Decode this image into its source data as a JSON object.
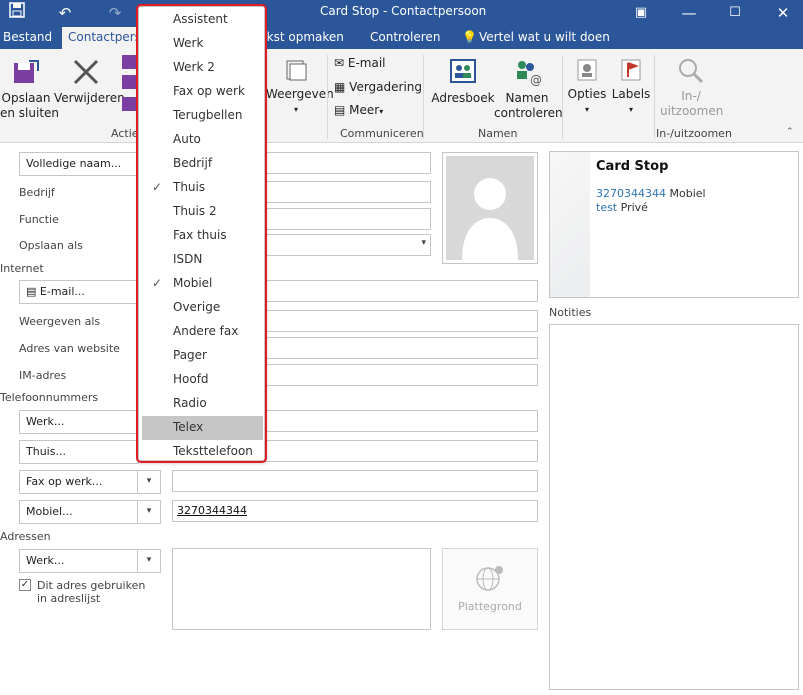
{
  "window": {
    "title": "Card Stop  - Contactpersoon"
  },
  "tabs": {
    "file": "Bestand",
    "contact": "Contactpersoon",
    "format": "Tekst opmaken",
    "review": "Controleren",
    "tell": "Vertel wat u wilt doen"
  },
  "ribbon": {
    "save_close_1": "Opslaan",
    "save_close_2": "en sluiten",
    "delete": "Verwijderen",
    "actions_group": "Acties",
    "show": "Weergeven",
    "email": "E-mail",
    "meeting": "Vergadering",
    "more": "Meer",
    "communicate_group": "Communiceren",
    "addressbook": "Adresboek",
    "check_names_1": "Namen",
    "check_names_2": "controleren",
    "names_group": "Namen",
    "options": "Opties",
    "labels": "Labels",
    "zoom_1": "In-/",
    "zoom_2": "uitzoomen",
    "zoom_group": "In-/uitzoomen"
  },
  "form": {
    "full_name_btn": "Volledige naam...",
    "company": "Bedrijf",
    "job_title": "Functie",
    "file_as": "Opslaan als",
    "internet_section": "Internet",
    "email_btn": "E-mail...",
    "display_as": "Weergeven als",
    "website": "Adres van website",
    "im": "IM-adres",
    "phone_section": "Telefoonnummers",
    "phone1": "Werk...",
    "phone2": "Thuis...",
    "phone3": "Fax op werk...",
    "phone4": "Mobiel...",
    "mobile_value": "3270344344",
    "address_section": "Adressen",
    "address_btn": "Werk...",
    "mailing_checkbox": "Dit adres gebruiken in adreslijst",
    "map_btn": "Plattegrond"
  },
  "dropdown": {
    "items": [
      {
        "label": "Assistent",
        "checked": false
      },
      {
        "label": "Werk",
        "checked": false
      },
      {
        "label": "Werk 2",
        "checked": false
      },
      {
        "label": "Fax op werk",
        "checked": false
      },
      {
        "label": "Terugbellen",
        "checked": false
      },
      {
        "label": "Auto",
        "checked": false
      },
      {
        "label": "Bedrijf",
        "checked": false
      },
      {
        "label": "Thuis",
        "checked": true
      },
      {
        "label": "Thuis 2",
        "checked": false
      },
      {
        "label": "Fax thuis",
        "checked": false
      },
      {
        "label": "ISDN",
        "checked": false
      },
      {
        "label": "Mobiel",
        "checked": true
      },
      {
        "label": "Overige",
        "checked": false
      },
      {
        "label": "Andere fax",
        "checked": false
      },
      {
        "label": "Pager",
        "checked": false
      },
      {
        "label": "Hoofd",
        "checked": false
      },
      {
        "label": "Radio",
        "checked": false
      },
      {
        "label": "Telex",
        "checked": false,
        "hovered": true
      },
      {
        "label": "Teksttelefoon",
        "checked": false
      }
    ]
  },
  "card": {
    "name": "Card Stop",
    "phone": "3270344344",
    "phone_label": "Mobiel",
    "email": "test",
    "email_label": "Privé"
  },
  "notes": {
    "label": "Notities"
  },
  "colors": {
    "accent": "#2b579a",
    "highlight": "#e01b24",
    "link": "#2e75b6"
  }
}
